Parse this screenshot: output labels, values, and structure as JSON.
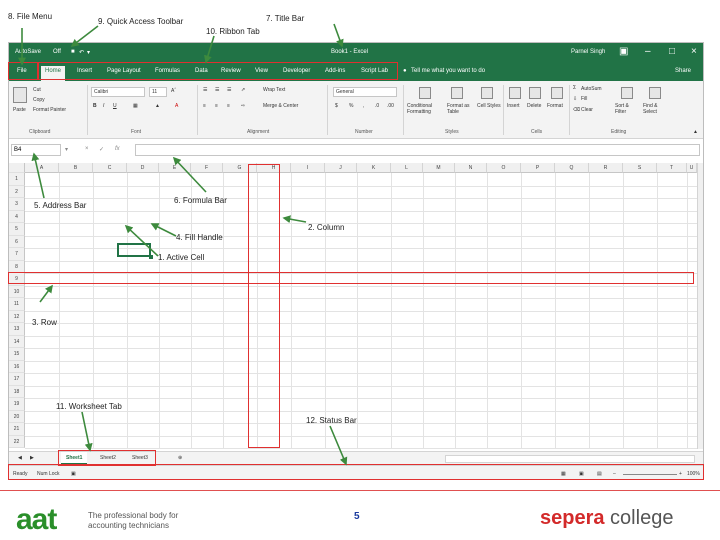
{
  "annotations": {
    "file_menu": "8. File Menu",
    "quick_access": "9. Quick Access Toolbar",
    "title_bar": "7. Title Bar",
    "ribbon_tab": "10. Ribbon Tab",
    "address_bar": "5. Address Bar",
    "formula_bar": "6. Formula Bar",
    "column": "2. Column",
    "fill_handle": "4. Fill Handle",
    "active_cell": "1. Active Cell",
    "row": "3. Row",
    "worksheet_tab": "11. Worksheet Tab",
    "status_bar": "12. Status Bar"
  },
  "titlebar": {
    "autosave": "AutoSave",
    "off": "Off",
    "title": "Book1 - Excel",
    "user": "Parnel Singh"
  },
  "tabs": [
    "File",
    "Home",
    "Insert",
    "Page Layout",
    "Formulas",
    "Data",
    "Review",
    "View",
    "Developer",
    "Add-ins",
    "Script Lab"
  ],
  "tell_me": "Tell me what you want to do",
  "share": "Share",
  "ribbon": {
    "paste": "Paste",
    "cut": "Cut",
    "copy": "Copy",
    "format_painter": "Format Painter",
    "font_name": "Calibri",
    "font_size": "11",
    "wrap_text": "Wrap Text",
    "merge_center": "Merge & Center",
    "number_format": "General",
    "conditional_formatting": "Conditional Formatting",
    "format_as_table": "Format as Table",
    "cell_styles": "Cell Styles",
    "insert": "Insert",
    "delete": "Delete",
    "format": "Format",
    "autosum": "AutoSum",
    "fill": "Fill",
    "clear": "Clear",
    "sort_filter": "Sort & Filter",
    "find_select": "Find & Select",
    "groups": [
      "Clipboard",
      "Font",
      "Alignment",
      "Number",
      "Styles",
      "Cells",
      "Editing"
    ]
  },
  "namebox": "B4",
  "columns": [
    "A",
    "B",
    "C",
    "D",
    "E",
    "F",
    "G",
    "H",
    "I",
    "J",
    "K",
    "L",
    "M",
    "N",
    "O",
    "P",
    "Q",
    "R",
    "S",
    "T",
    "U"
  ],
  "rows": [
    "1",
    "2",
    "3",
    "4",
    "5",
    "6",
    "7",
    "8",
    "9",
    "10",
    "11",
    "12",
    "13",
    "14",
    "15",
    "16",
    "17",
    "18",
    "19",
    "20",
    "21",
    "22"
  ],
  "sheets": [
    "Sheet1",
    "Sheet2",
    "Sheet3"
  ],
  "status": {
    "ready": "Ready",
    "num_lock": "Num Lock",
    "zoom": "100%"
  },
  "footer": {
    "logo": "aat",
    "tagline_1": "The professional body for",
    "tagline_2": "accounting technicians",
    "page_number": "5",
    "brand_1": "sepera",
    "brand_2": " college"
  },
  "colors": {
    "excel_green": "#217346",
    "annotation_red": "#e03030",
    "arrow_green": "#3d8a3d"
  }
}
